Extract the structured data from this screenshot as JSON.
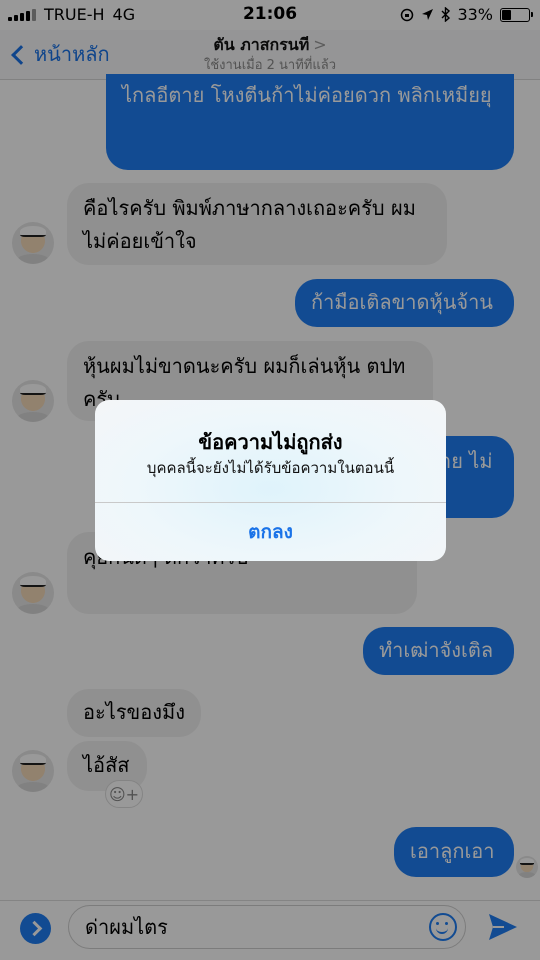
{
  "status": {
    "carrier": "TRUE-H",
    "network": "4G",
    "time": "21:06",
    "battery": "33%",
    "battery_level": 0.33
  },
  "nav": {
    "back_label": "หน้าหลัก",
    "contact_name": "ตัน ภาสกรนที",
    "chevron": ">",
    "active_status": "ใช้งานเมื่อ 2 นาทีที่แล้ว"
  },
  "messages": [
    {
      "side": "out",
      "text": "ไกลอีตาย โหงตีนก้าไม่ค่อยดวก พลิกเหมียยุ"
    },
    {
      "side": "in",
      "text": "คือไรครับ พิมพ์ภาษากลางเถอะครับ ผมไม่ค่อยเข้าใจ"
    },
    {
      "side": "out",
      "text": "ก้ามือเติลขาดหุ้นจ้าน"
    },
    {
      "side": "in",
      "text": "หุ้นผมไม่ขาดนะครับ ผมก็เล่นหุ้น ตปท ครับ"
    },
    {
      "side": "out",
      "text": "าย ไม่"
    },
    {
      "side": "in",
      "text": "คุยกันดีๆ ดีกว่าครับ"
    },
    {
      "side": "out",
      "text": "ทำเฒ่าจังเติล"
    },
    {
      "side": "in",
      "text": "อะไรของมึง"
    },
    {
      "side": "in",
      "text": "ไอ้สัส"
    },
    {
      "side": "out",
      "text": "เอาลูกเอา"
    }
  ],
  "composer": {
    "input_value": "ด่าผมไตร",
    "accent": "#1e7ef4"
  },
  "alert": {
    "title": "ข้อความไม่ถูกส่ง",
    "message": "บุคคลนี้จะยังไม่ได้รับข้อความในตอนนี้",
    "button": "ตกลง"
  },
  "colors": {
    "outgoing_bubble": "#1e7ef4",
    "incoming_bubble": "#f0f0f0",
    "link": "#1a73e8"
  },
  "icons": {
    "back": "chevron-left-icon",
    "add": "plus-circle-icon",
    "emoji": "smiley-icon",
    "send": "send-icon",
    "reaction": "add-reaction-icon"
  }
}
